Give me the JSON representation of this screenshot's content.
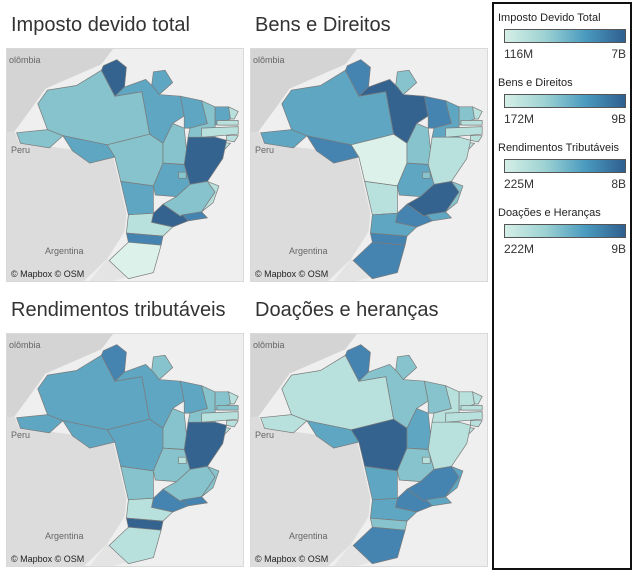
{
  "chart_data": [
    {
      "type": "map",
      "title": "Imposto devido total",
      "map_labels": {
        "country_top": "olômbia",
        "city": "Peru",
        "country_bottom": "Argentina",
        "credit": "© Mapbox © OSM"
      }
    },
    {
      "type": "map",
      "title": "Bens e Direitos",
      "map_labels": {
        "country_top": "olômbia",
        "city": "Peru",
        "country_bottom": "Argentina",
        "credit": "© Mapbox © OSM"
      }
    },
    {
      "type": "map",
      "title": "Rendimentos tributáveis",
      "map_labels": {
        "country_top": "olômbia",
        "city": "Peru",
        "country_bottom": "Argentina",
        "credit": "© Mapbox © OSM"
      }
    },
    {
      "type": "map",
      "title": "Doações e heranças",
      "map_labels": {
        "country_top": "olômbia",
        "city": "Peru",
        "country_bottom": "Argentina",
        "credit": "© Mapbox © OSM"
      }
    }
  ],
  "legend": [
    {
      "title": "Imposto Devido Total",
      "min": "116M",
      "max": "7B"
    },
    {
      "title": "Bens e Direitos",
      "min": "172M",
      "max": "9B"
    },
    {
      "title": "Rendimentos Tributáveis",
      "min": "225M",
      "max": "8B"
    },
    {
      "title": "Doações e Heranças",
      "min": "222M",
      "max": "9B"
    }
  ],
  "colors": {
    "low": "#d5efe7",
    "mid": "#9dd2d3",
    "high": "#4a9bbf",
    "max": "#2f5f8f",
    "land": "#dcdcdc",
    "background": "#efefef"
  },
  "state_shades": [
    {
      "AM": 2,
      "RR": 5,
      "AP": 3,
      "PA": 3,
      "AC": 2,
      "RO": 3,
      "MT": 2,
      "TO": 2,
      "MA": 3,
      "PI": 2,
      "CE": 3,
      "RN": 1,
      "PB": 1,
      "PE": 1,
      "AL": 1,
      "SE": 1,
      "BA": 5,
      "MS": 3,
      "GO": 3,
      "DF": 2,
      "MG": 2,
      "ES": 1,
      "RJ": 4,
      "SP": 5,
      "PR": 1,
      "SC": 4,
      "RS": 0
    },
    {
      "AM": 3,
      "RR": 4,
      "AP": 2,
      "PA": 5,
      "AC": 3,
      "RO": 4,
      "MT": 0,
      "TO": 2,
      "MA": 4,
      "PI": 3,
      "CE": 2,
      "RN": 1,
      "PB": 1,
      "PE": 1,
      "AL": 1,
      "SE": 1,
      "BA": 1,
      "MS": 1,
      "GO": 3,
      "DF": 2,
      "MG": 5,
      "ES": 2,
      "RJ": 3,
      "SP": 4,
      "PR": 3,
      "SC": 4,
      "RS": 4
    },
    {
      "AM": 3,
      "RR": 4,
      "AP": 2,
      "PA": 3,
      "AC": 3,
      "RO": 3,
      "MT": 3,
      "TO": 2,
      "MA": 3,
      "PI": 2,
      "CE": 2,
      "RN": 1,
      "PB": 2,
      "PE": 1,
      "AL": 1,
      "SE": 1,
      "BA": 5,
      "MS": 2,
      "GO": 2,
      "DF": 1,
      "MG": 2,
      "ES": 2,
      "RJ": 4,
      "SP": 4,
      "PR": 1,
      "SC": 5,
      "RS": 1
    },
    {
      "AM": 1,
      "RR": 4,
      "AP": 2,
      "PA": 2,
      "AC": 1,
      "RO": 3,
      "MT": 5,
      "TO": 3,
      "MA": 2,
      "PI": 1,
      "CE": 1,
      "RN": 1,
      "PB": 1,
      "PE": 1,
      "AL": 1,
      "SE": 1,
      "BA": 1,
      "MS": 3,
      "GO": 2,
      "DF": 1,
      "MG": 4,
      "ES": 3,
      "RJ": 3,
      "SP": 4,
      "PR": 3,
      "SC": 2,
      "RS": 4
    }
  ]
}
